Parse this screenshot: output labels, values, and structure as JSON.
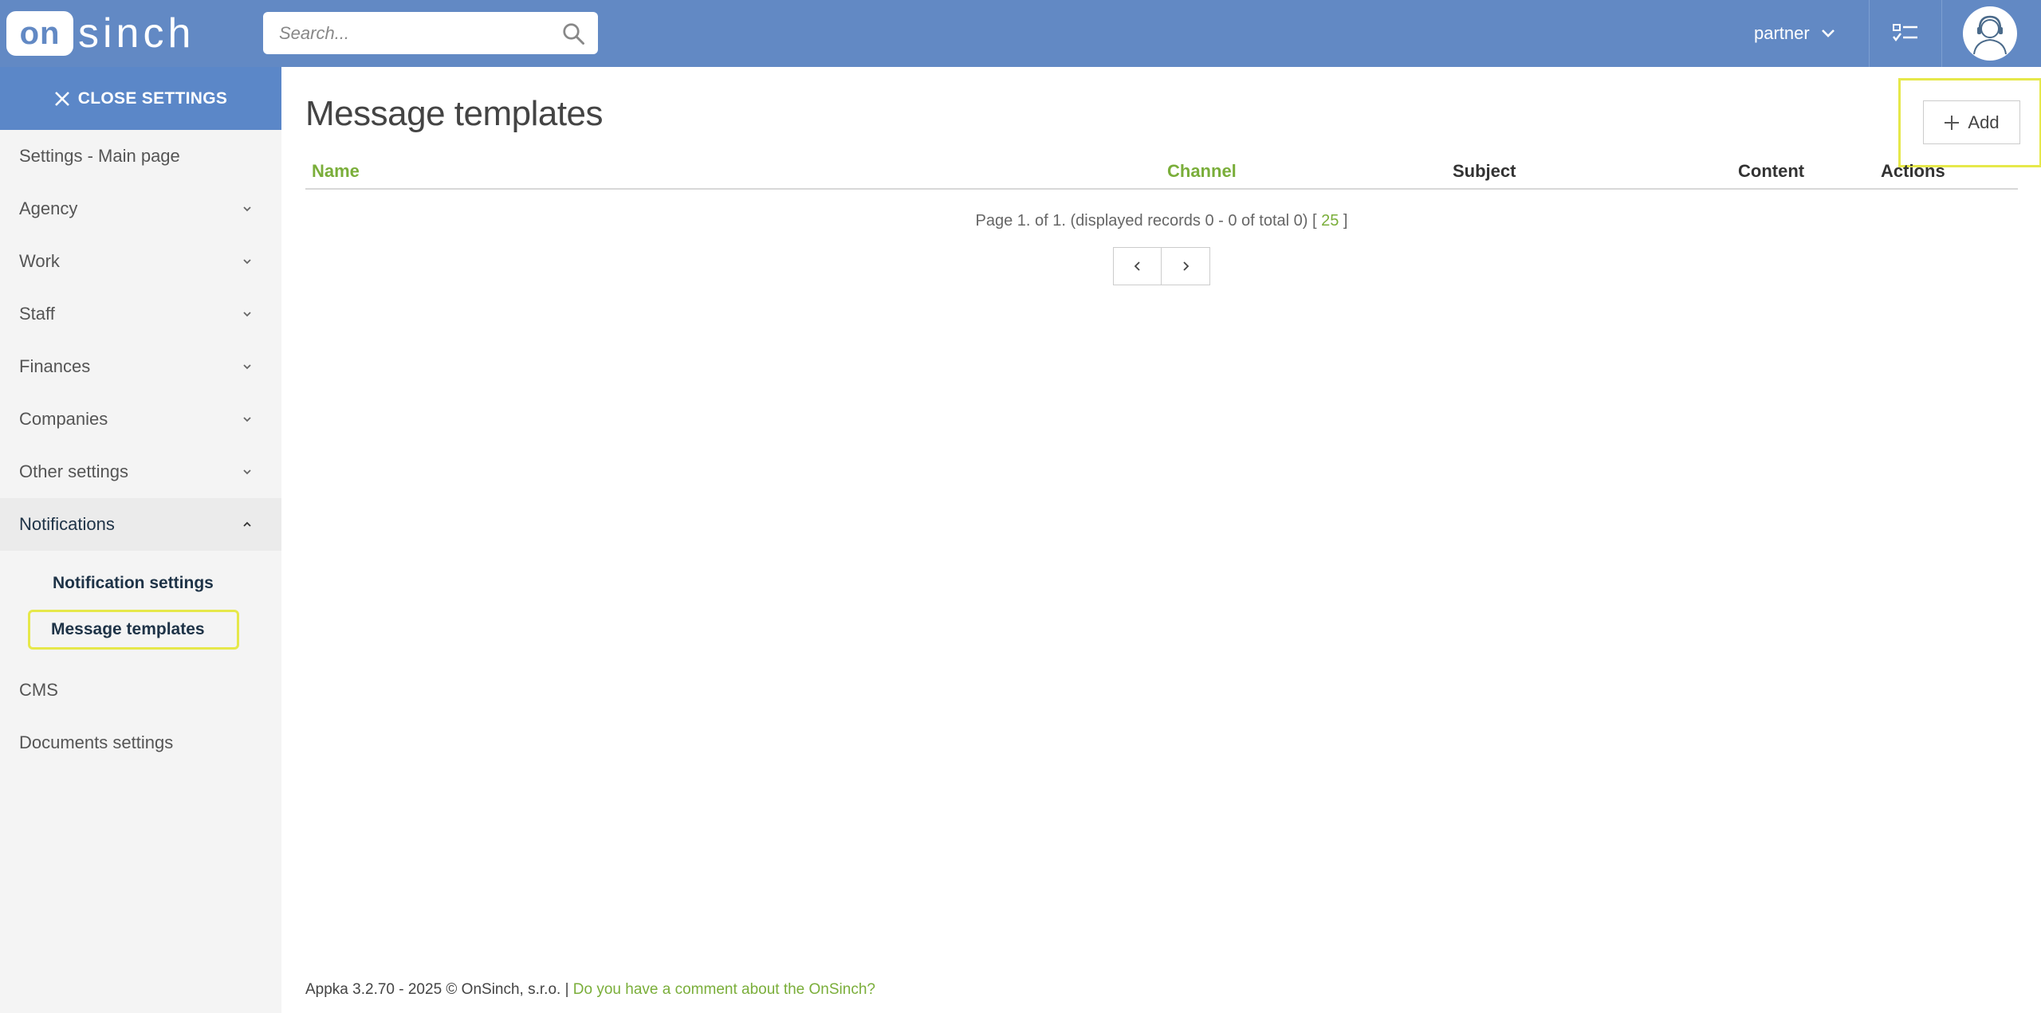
{
  "header": {
    "logo_box": "on",
    "logo_text": "sinch",
    "search_placeholder": "Search...",
    "user_label": "partner"
  },
  "sidebar": {
    "close_label": "CLOSE SETTINGS",
    "items": [
      {
        "label": "Settings - Main page"
      },
      {
        "label": "Agency"
      },
      {
        "label": "Work"
      },
      {
        "label": "Staff"
      },
      {
        "label": "Finances"
      },
      {
        "label": "Companies"
      },
      {
        "label": "Other settings"
      },
      {
        "label": "Notifications"
      }
    ],
    "sub_items": [
      {
        "label": "Notification settings"
      },
      {
        "label": "Message templates"
      }
    ],
    "bottom_items": [
      {
        "label": "CMS"
      },
      {
        "label": "Documents settings"
      }
    ]
  },
  "main": {
    "title": "Message templates",
    "add_label": "Add",
    "columns": {
      "name": "Name",
      "channel": "Channel",
      "subject": "Subject",
      "content": "Content",
      "actions": "Actions"
    },
    "pager": {
      "text": "Page 1. of 1. (displayed records 0 - 0 of total 0) [",
      "page_size": "25",
      "close": "]"
    }
  },
  "footer": {
    "text": "Appka 3.2.70 - 2025 © OnSinch, s.r.o. |",
    "link": "Do you have a comment about the OnSinch?"
  },
  "colors": {
    "topbar": "#6289c4",
    "accent_green": "#7aae3a",
    "highlight": "#e6e84a"
  }
}
